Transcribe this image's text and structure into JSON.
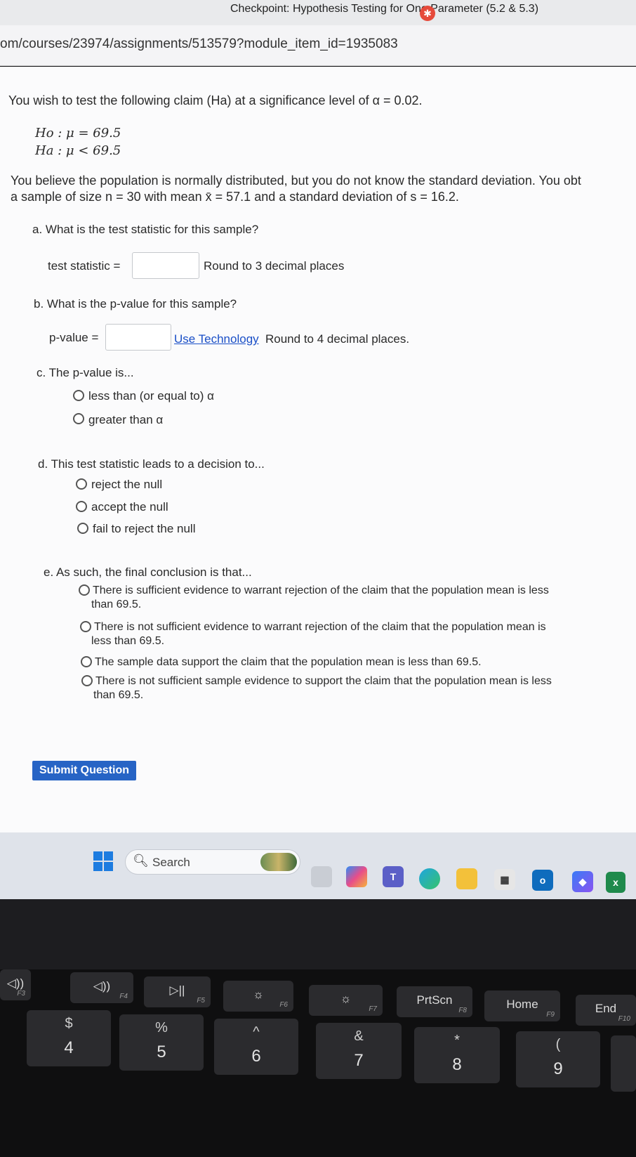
{
  "browser": {
    "tab_title": "Checkpoint: Hypothesis Testing for One Parameter (5.2 & 5.3)",
    "url": "om/courses/23974/assignments/513579?module_item_id=1935083"
  },
  "question": {
    "intro": "You wish to test the following claim (Ha) at a significance level of α = 0.02.",
    "h0": "Ho : μ = 69.5",
    "ha": "Ha : μ < 69.5",
    "sample_line1": "You believe the population is normally distributed, but you do not know the standard deviation. You obt",
    "sample_line2": "a sample of size n = 30 with mean x̄ = 57.1 and a standard deviation of s = 16.2.",
    "part_a": {
      "prompt": "a. What is the test statistic for this sample?",
      "label": "test statistic =",
      "value": "",
      "hint": "Round to 3 decimal places"
    },
    "part_b": {
      "prompt": "b. What is the p-value for this sample?",
      "label": "p-value =",
      "value": "",
      "link": "Use Technology",
      "hint": "Round to 4 decimal places."
    },
    "part_c": {
      "prompt": "c. The p-value is...",
      "options": [
        "less than (or equal to) α",
        "greater than α"
      ]
    },
    "part_d": {
      "prompt": "d. This test statistic leads to a decision to...",
      "options": [
        "reject the null",
        "accept the null",
        "fail to reject the null"
      ]
    },
    "part_e": {
      "prompt": "e. As such, the final conclusion is that...",
      "options": [
        {
          "line1": "There is sufficient evidence to warrant rejection of the claim that the population mean is less",
          "line2": "than 69.5."
        },
        {
          "line1": "There is not sufficient evidence to warrant rejection of the claim that the population mean is",
          "line2": "less than 69.5."
        },
        {
          "line1": "The sample data support the claim that the population mean is less than 69.5.",
          "line2": ""
        },
        {
          "line1": "There is not sufficient sample evidence to support the claim that the population mean is less",
          "line2": "than 69.5."
        }
      ]
    },
    "submit_label": "Submit Question"
  },
  "taskbar": {
    "search_label": "Search",
    "icons": [
      "windows-start",
      "search",
      "file-explorer",
      "copilot",
      "teams",
      "edge",
      "folder",
      "store",
      "outlook",
      "vpn",
      "excel"
    ]
  },
  "keyboard": {
    "fkeys": [
      {
        "top": "◁))",
        "sub": "F3"
      },
      {
        "top": "◁))",
        "sub": "F4"
      },
      {
        "top": "▷||",
        "sub": "F5"
      },
      {
        "top": "☼",
        "sub": "F6"
      },
      {
        "top": "☼",
        "sub": "F7"
      },
      {
        "top": "PrtScn",
        "sub": "F8"
      },
      {
        "top": "Home",
        "sub": "F9"
      },
      {
        "top": "End",
        "sub": "F10"
      }
    ],
    "numkeys": [
      {
        "top": "$",
        "bot": "4"
      },
      {
        "top": "%",
        "bot": "5"
      },
      {
        "top": "^",
        "bot": "6"
      },
      {
        "top": "&",
        "bot": "7"
      },
      {
        "top": "*",
        "bot": "8"
      },
      {
        "top": "(",
        "bot": "9"
      }
    ]
  }
}
